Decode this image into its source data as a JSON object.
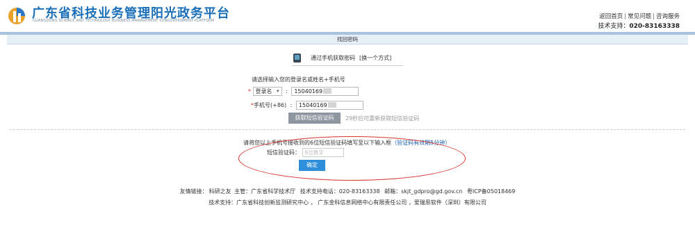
{
  "header": {
    "title": "广东省科技业务管理阳光政务平台",
    "subtitle": "GUANGDONG SCIENCE AND TECHNOLOGY BUSINESS MANAGEMENT SUNGOVERNMENT PLATFORM",
    "links": [
      "返回首页",
      "常见问题",
      "咨询服务"
    ],
    "support_label": "技术支持：",
    "support_phone": "020-83163338"
  },
  "section": {
    "title": "找回密码"
  },
  "method": {
    "label": "通过手机获取密码",
    "switch_label": "[换一个方式]"
  },
  "hint": "请选择输入您的登录名或姓名+手机号",
  "form": {
    "account": {
      "required_mark": "*",
      "select_value": "登录名",
      "input_value": "15040169"
    },
    "phone": {
      "required_mark": "*",
      "label": "手机号(+86)",
      "input_value": "15040169"
    },
    "sms_button": "获取短信验证码",
    "countdown": "29秒后可重新获取短信验证码"
  },
  "verify": {
    "instruction": "请将您以上手机号接收到的6位短信验证码填写至以下输入框",
    "validity": "（验证码有效期5分钟）",
    "code_label": "短信验证码：",
    "code_placeholder": "6位数字",
    "confirm_button": "确定"
  },
  "footer": {
    "links_label": "友情链接：",
    "links_value": "科研之友",
    "sponsor": "主管：广东省科学技术厅",
    "hotline": "技术支持电话：020-83163338",
    "email": "邮箱：skjt_gdpro@gd.gov.cn",
    "icp": "粤ICP备05018469",
    "support_line": "技术支持：广东省科技创新监测研究中心 ， 广东金科信息网络中心有限责任公司 ，爱瑞思软件（深圳）有限公司"
  },
  "colors": {
    "brand": "#1a6fb8",
    "confirm": "#2e8ed9",
    "highlight": "#d8322c"
  }
}
